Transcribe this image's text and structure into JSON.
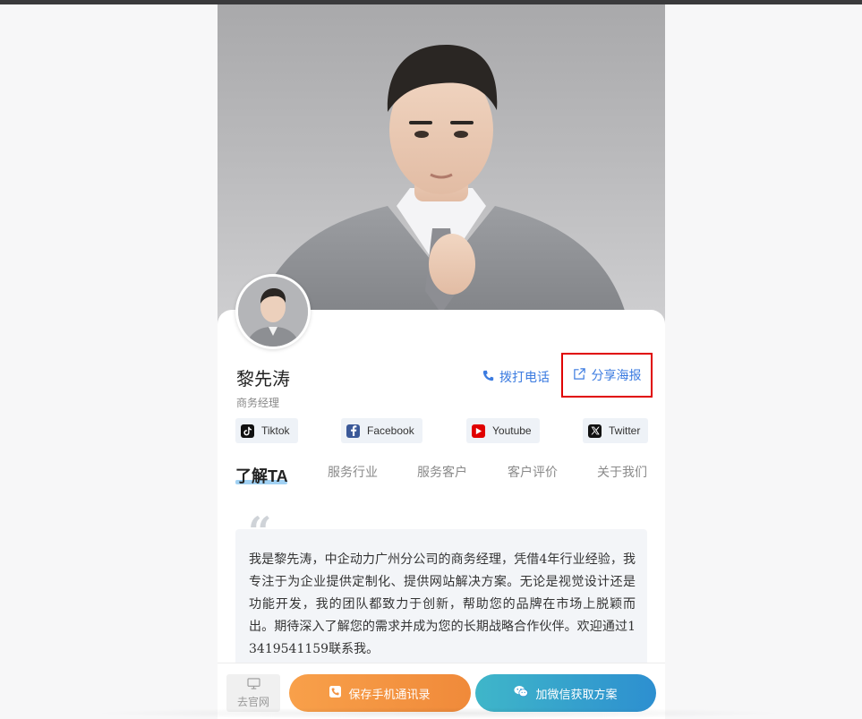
{
  "profile": {
    "name": "黎先涛",
    "role": "商务经理",
    "call_label": "拨打电话",
    "share_label": "分享海报"
  },
  "socials": [
    {
      "label": "Tiktok",
      "icon": "tiktok-icon",
      "color": "#111111"
    },
    {
      "label": "Facebook",
      "icon": "facebook-icon",
      "color": "#3b5998"
    },
    {
      "label": "Youtube",
      "icon": "youtube-icon",
      "color": "#e00000"
    },
    {
      "label": "Twitter",
      "icon": "x-twitter-icon",
      "color": "#111111"
    }
  ],
  "tabs": [
    {
      "label": "了解TA",
      "active": true
    },
    {
      "label": "服务行业",
      "active": false
    },
    {
      "label": "服务客户",
      "active": false
    },
    {
      "label": "客户评价",
      "active": false
    },
    {
      "label": "关于我们",
      "active": false
    }
  ],
  "bio": {
    "quote_mark": "“",
    "text": "我是黎先涛，中企动力广州分公司的商务经理，凭借4年行业经验，我专注于为企业提供定制化、提供网站解决方案。无论是视觉设计还是功能开发，我的团队都致力于创新，帮助您的品牌在市场上脱颖而出。期待深入了解您的需求并成为您的长期战略合作伙伴。欢迎通过13419541159联系我。"
  },
  "bottom": {
    "site_label": "去官网",
    "save_label": "保存手机通讯录",
    "wechat_label": "加微信获取方案"
  },
  "colors": {
    "accent_blue": "#3b7be0",
    "save_orange": "#f39343",
    "wechat_teal": "#2d8fd0",
    "highlight_red": "#e00000"
  }
}
